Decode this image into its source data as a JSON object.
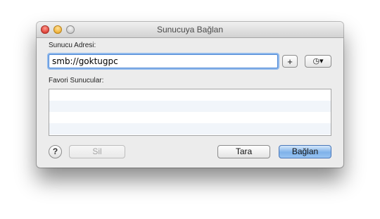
{
  "window": {
    "title": "Sunucuya Bağlan"
  },
  "server_address": {
    "label": "Sunucu Adresi:",
    "value": "smb://goktugpc"
  },
  "buttons": {
    "add_label": "+",
    "history_label": "◷▾",
    "remove_label": "Sil",
    "browse_label": "Tara",
    "connect_label": "Bağlan",
    "help_label": "?"
  },
  "favorites": {
    "label": "Favori Sunucular:",
    "items": []
  },
  "colors": {
    "primary_button": "#7fb2ea",
    "focus_ring": "#90b9ec"
  }
}
